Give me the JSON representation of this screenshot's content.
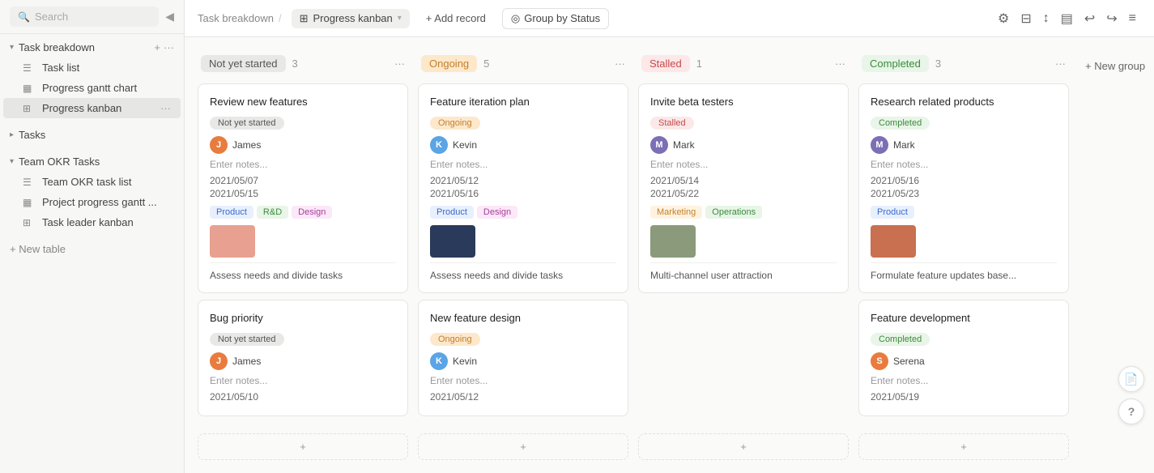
{
  "sidebar": {
    "search_placeholder": "Search",
    "collapse_icon": "◀",
    "sections": [
      {
        "name": "task-breakdown",
        "label": "Task breakdown",
        "items": [
          {
            "id": "task-list",
            "label": "Task list",
            "icon": "☰"
          },
          {
            "id": "progress-gantt-chart",
            "label": "Progress gantt chart",
            "icon": "▦"
          },
          {
            "id": "progress-kanban",
            "label": "Progress kanban",
            "icon": "⊞",
            "active": true
          }
        ]
      },
      {
        "name": "tasks",
        "label": "Tasks",
        "items": []
      },
      {
        "name": "team-okr-tasks",
        "label": "Team OKR Tasks",
        "items": [
          {
            "id": "team-okr-task-list",
            "label": "Team OKR task list",
            "icon": "☰"
          },
          {
            "id": "project-progress-gantt",
            "label": "Project progress gantt ...",
            "icon": "▦"
          },
          {
            "id": "task-leader-kanban",
            "label": "Task leader kanban",
            "icon": "⊞"
          }
        ]
      }
    ],
    "new_table_label": "+ New table"
  },
  "topbar": {
    "breadcrumb_root": "Task breakdown",
    "separator": "/",
    "view_icon": "⊞",
    "view_label": "Progress kanban",
    "add_record_label": "+ Add record",
    "group_by_label": "Group by Status",
    "group_by_icon": "◎",
    "settings_icon": "⚙",
    "filter_icon": "⊟",
    "sort_icon": "↕",
    "layout_icon": "▤",
    "undo_icon": "↩",
    "redo_icon": "↪",
    "more_icon": "≡"
  },
  "columns": [
    {
      "id": "not-yet-started",
      "title": "Not yet started",
      "badge_class": "badge-not-started",
      "count": 3,
      "cards": [
        {
          "id": "card-1",
          "title": "Review new features",
          "status": "Not yet started",
          "status_class": "status-not-started",
          "user_initial": "J",
          "user_name": "James",
          "user_class": "avatar-j",
          "notes": "Enter notes...",
          "date1": "2021/05/07",
          "date2": "2021/05/15",
          "tags": [
            {
              "label": "Product",
              "class": "tag-product"
            },
            {
              "label": "R&D",
              "class": "tag-rd"
            },
            {
              "label": "Design",
              "class": "tag-design"
            }
          ],
          "has_image": true,
          "image_color": "#e8a090",
          "subtask": "Assess needs and divide tasks"
        },
        {
          "id": "card-2",
          "title": "Bug priority",
          "status": "Not yet started",
          "status_class": "status-not-started",
          "user_initial": "J",
          "user_name": "James",
          "user_class": "avatar-j",
          "notes": "Enter notes...",
          "date1": "2021/05/10",
          "date2": "",
          "tags": [],
          "has_image": false,
          "subtask": ""
        }
      ]
    },
    {
      "id": "ongoing",
      "title": "Ongoing",
      "badge_class": "badge-ongoing",
      "count": 5,
      "cards": [
        {
          "id": "card-3",
          "title": "Feature iteration plan",
          "status": "Ongoing",
          "status_class": "status-ongoing",
          "user_initial": "K",
          "user_name": "Kevin",
          "user_class": "avatar-k",
          "notes": "Enter notes...",
          "date1": "2021/05/12",
          "date2": "2021/05/16",
          "tags": [
            {
              "label": "Product",
              "class": "tag-product"
            },
            {
              "label": "Design",
              "class": "tag-design"
            }
          ],
          "has_image": true,
          "image_color": "#2a3a5a",
          "subtask": "Assess needs and divide tasks"
        },
        {
          "id": "card-4",
          "title": "New feature design",
          "status": "Ongoing",
          "status_class": "status-ongoing",
          "user_initial": "K",
          "user_name": "Kevin",
          "user_class": "avatar-k",
          "notes": "Enter notes...",
          "date1": "2021/05/12",
          "date2": "",
          "tags": [],
          "has_image": false,
          "subtask": ""
        }
      ]
    },
    {
      "id": "stalled",
      "title": "Stalled",
      "badge_class": "badge-stalled",
      "count": 1,
      "cards": [
        {
          "id": "card-5",
          "title": "Invite beta testers",
          "status": "Stalled",
          "status_class": "status-stalled",
          "user_initial": "M",
          "user_name": "Mark",
          "user_class": "avatar-m",
          "notes": "Enter notes...",
          "date1": "2021/05/14",
          "date2": "2021/05/22",
          "tags": [
            {
              "label": "Marketing",
              "class": "tag-marketing"
            },
            {
              "label": "Operations",
              "class": "tag-operations"
            }
          ],
          "has_image": true,
          "image_color": "#8a9a7a",
          "subtask": "Multi-channel user attraction"
        }
      ]
    },
    {
      "id": "completed",
      "title": "Completed",
      "badge_class": "badge-completed",
      "count": 3,
      "cards": [
        {
          "id": "card-6",
          "title": "Research related products",
          "status": "Completed",
          "status_class": "status-completed",
          "user_initial": "M",
          "user_name": "Mark",
          "user_class": "avatar-m",
          "notes": "Enter notes...",
          "date1": "2021/05/16",
          "date2": "2021/05/23",
          "tags": [
            {
              "label": "Product",
              "class": "tag-product"
            }
          ],
          "has_image": true,
          "image_color": "#c87050",
          "subtask": "Formulate feature updates base..."
        },
        {
          "id": "card-7",
          "title": "Feature development",
          "status": "Completed",
          "status_class": "status-completed",
          "user_initial": "S",
          "user_name": "Serena",
          "user_class": "avatar-s",
          "notes": "Enter notes...",
          "date1": "2021/05/19",
          "date2": "",
          "tags": [],
          "has_image": false,
          "subtask": ""
        }
      ]
    }
  ],
  "new_group_label": "+ New group",
  "add_card_icon": "+",
  "tasks_section_label": "Tasks",
  "floating": {
    "doc_icon": "📄",
    "help_icon": "?"
  }
}
